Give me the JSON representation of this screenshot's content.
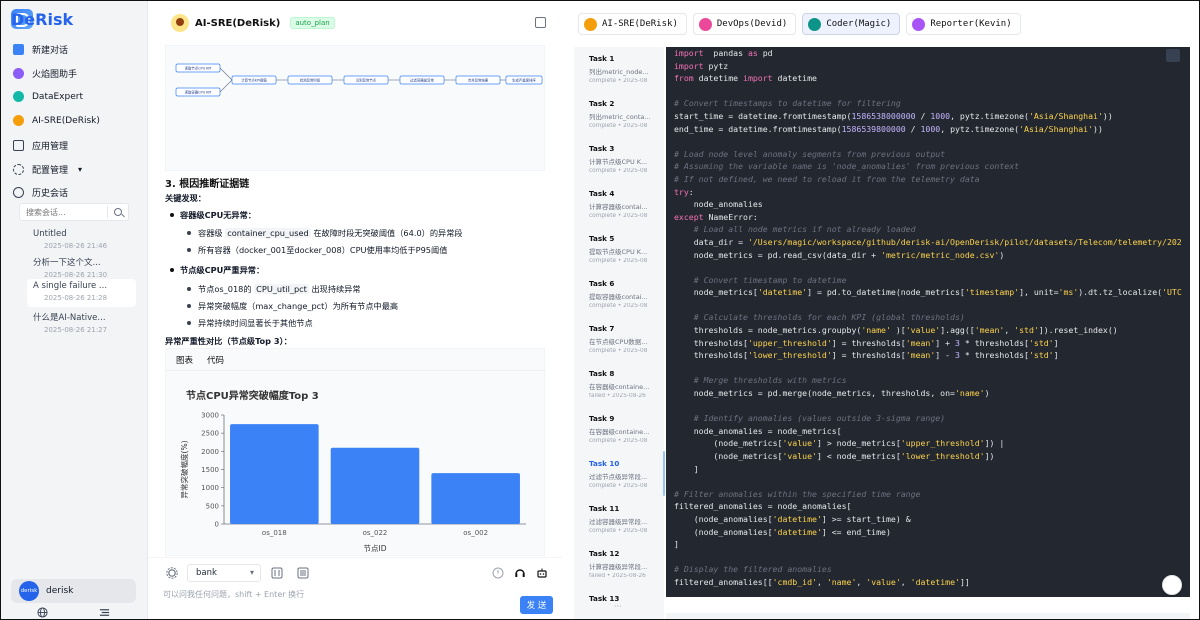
{
  "app": {
    "name": "DeRisk"
  },
  "sidebar": {
    "items": [
      {
        "label": "新建对话",
        "color": "#3b82f6"
      },
      {
        "label": "火焰图助手",
        "color": "#8b5cf6"
      },
      {
        "label": "DataExpert",
        "color": "#14b8a6"
      },
      {
        "label": "AI-SRE(DeRisk)",
        "color": "#f59e0b"
      },
      {
        "label": "应用管理",
        "color": "#6b7280"
      },
      {
        "label": "配置管理",
        "color": "#6b7280"
      },
      {
        "label": "历史会话",
        "color": "#6b7280"
      }
    ],
    "search_placeholder": "搜索会话...",
    "history": [
      {
        "title": "Untitled",
        "date": "2025-08-26 21:46"
      },
      {
        "title": "分析一下这个文...",
        "date": "2025-08-26 21:30"
      },
      {
        "title": "A single failure ...",
        "date": "2025-08-26 21:28"
      },
      {
        "title": "什么是AI-Native...",
        "date": "2025-08-26 21:27"
      }
    ],
    "user": {
      "avatar_text": "derisk",
      "name": "derisk"
    }
  },
  "chat": {
    "header_title": "AI-SRE(DeRisk)",
    "header_badge": "auto_plan",
    "section_title": "3. 根因推断证据链",
    "key_findings_label": "关键发现：",
    "finding1_title": "容器级CPU无异常：",
    "finding1_a_pre": "容器级",
    "finding1_a_code": "container_cpu_used",
    "finding1_a_post": "在故障时段无突破阈值（64.0）的异常段",
    "finding1_b": "所有容器（docker_001至docker_008）CPU使用率均低于P95阈值",
    "finding2_title": "节点级CPU严重异常：",
    "finding2_a_pre": "节点os_018的",
    "finding2_a_code": "CPU_util_pct",
    "finding2_a_post": "出现持续异常",
    "finding2_b": "异常突破幅度（max_change_pct）为所有节点中最高",
    "finding2_c": "异常持续时间显著长于其他节点",
    "compare_label": "异常严重性对比（节点级Top 3）：",
    "chart_tab_1": "图表",
    "chart_tab_2": "代码",
    "model_value": "bank",
    "input_placeholder": "可以问我任何问题，shift + Enter 换行",
    "send_label": "发 送",
    "flow_nodes": [
      "读取节点CPU KPI",
      "读取容器CPU KPI",
      "计算节点KPI阈值",
      "检测异常时段",
      "识别异常节点",
      "过滤容器级异常",
      "合并异常结果",
      "生成严重度排序"
    ]
  },
  "chart_data": {
    "type": "bar",
    "title": "节点CPU异常突破幅度Top 3",
    "xlabel": "节点ID",
    "ylabel": "异常突破幅度(%)",
    "categories": [
      "os_018",
      "os_022",
      "os_002"
    ],
    "values": [
      2750,
      2100,
      1400
    ],
    "ylim": [
      0,
      3000
    ],
    "yticks": [
      0,
      500,
      1000,
      1500,
      2000,
      2500,
      3000
    ],
    "bar_color": "#3b82f6",
    "grid": false
  },
  "right": {
    "tabs": [
      {
        "label": "AI-SRE(DeRisk)",
        "color": "#f59e0b",
        "active": false
      },
      {
        "label": "DevOps(Devid)",
        "color": "#ec4899",
        "active": false
      },
      {
        "label": "Coder(Magic)",
        "color": "#0d9488",
        "active": true
      },
      {
        "label": "Reporter(Kevin)",
        "color": "#a855f7",
        "active": false
      }
    ],
    "tasks": [
      {
        "name": "Task 1",
        "desc": "列出metric_node...",
        "status": "complete • 2025-08"
      },
      {
        "name": "Task 2",
        "desc": "列出metric_conta...",
        "status": "complete • 2025-08"
      },
      {
        "name": "Task 3",
        "desc": "计算节点级CPU K...",
        "status": "complete • 2025-08"
      },
      {
        "name": "Task 4",
        "desc": "计算容器级contai...",
        "status": "complete • 2025-08"
      },
      {
        "name": "Task 5",
        "desc": "提取节点级CPU K...",
        "status": "complete • 2025-08"
      },
      {
        "name": "Task 6",
        "desc": "提取容器级contai...",
        "status": "complete • 2025-08"
      },
      {
        "name": "Task 7",
        "desc": "在节点级CPU数据...",
        "status": "complete • 2025-08"
      },
      {
        "name": "Task 8",
        "desc": "在容器级containe...",
        "status": "failed • 2025-08-26"
      },
      {
        "name": "Task 9",
        "desc": "在容器级containe...",
        "status": "complete • 2025-08"
      },
      {
        "name": "Task 10",
        "desc": "过滤节点级异常段...",
        "status": "complete • 2025-08"
      },
      {
        "name": "Task 11",
        "desc": "过滤容器级异常段...",
        "status": "complete • 2025-08"
      },
      {
        "name": "Task 12",
        "desc": "计算容器级异常段...",
        "status": "failed • 2025-08-26"
      },
      {
        "name": "Task 13",
        "desc": "",
        "status": ""
      }
    ],
    "active_task_index": 9,
    "code_lines": [
      [
        [
          "kw",
          "import"
        ],
        [
          "",
          "  pandas "
        ],
        [
          "kw",
          "as"
        ],
        [
          "",
          " pd"
        ]
      ],
      [
        [
          "kw",
          "import"
        ],
        [
          "",
          " pytz"
        ]
      ],
      [
        [
          "kw",
          "from"
        ],
        [
          "",
          " datetime "
        ],
        [
          "kw",
          "import"
        ],
        [
          "",
          " datetime"
        ]
      ],
      [],
      [
        [
          "cm",
          "# Convert timestamps to datetime for filtering"
        ]
      ],
      [
        [
          "",
          "start_time = datetime.fromtimestamp("
        ],
        [
          "nu",
          "1586538000000"
        ],
        [
          "",
          " / "
        ],
        [
          "nu",
          "1000"
        ],
        [
          "",
          ", pytz.timezone("
        ],
        [
          "st",
          "'Asia/Shanghai'"
        ],
        [
          "",
          "))"
        ]
      ],
      [
        [
          "",
          "end_time = datetime.fromtimestamp("
        ],
        [
          "nu",
          "1586539800000"
        ],
        [
          "",
          " / "
        ],
        [
          "nu",
          "1000"
        ],
        [
          "",
          ", pytz.timezone("
        ],
        [
          "st",
          "'Asia/Shanghai'"
        ],
        [
          "",
          "))"
        ]
      ],
      [],
      [
        [
          "cm",
          "# Load node level anomaly segments from previous output"
        ]
      ],
      [
        [
          "cm",
          "# Assuming the variable name is 'node_anomalies' from previous context"
        ]
      ],
      [
        [
          "cm",
          "# If not defined, we need to reload it from the telemetry data"
        ]
      ],
      [
        [
          "kw",
          "try"
        ],
        [
          "",
          ":"
        ]
      ],
      [
        [
          "",
          "    node_anomalies"
        ]
      ],
      [
        [
          "kw",
          "except"
        ],
        [
          "",
          " NameError:"
        ]
      ],
      [
        [
          "",
          "    "
        ],
        [
          "cm",
          "# Load all node metrics if not already loaded"
        ]
      ],
      [
        [
          "",
          "    data_dir = "
        ],
        [
          "st",
          "'/Users/magic/workspace/github/derisk-ai/OpenDerisk/pilot/datasets/Telecom/telemetry/202"
        ]
      ],
      [
        [
          "",
          "    node_metrics = pd.read_csv(data_dir + "
        ],
        [
          "st",
          "'metric/metric_node.csv'"
        ],
        [
          "",
          ")"
        ]
      ],
      [],
      [
        [
          "",
          "    "
        ],
        [
          "cm",
          "# Convert timestamp to datetime"
        ]
      ],
      [
        [
          "",
          "    node_metrics["
        ],
        [
          "st",
          "'datetime'"
        ],
        [
          "",
          "] = pd.to_datetime(node_metrics["
        ],
        [
          "st",
          "'timestamp'"
        ],
        [
          "",
          "], unit="
        ],
        [
          "st",
          "'ms'"
        ],
        [
          "",
          ").dt.tz_localize("
        ],
        [
          "st",
          "'UTC"
        ]
      ],
      [],
      [
        [
          "",
          "    "
        ],
        [
          "cm",
          "# Calculate thresholds for each KPI (global thresholds)"
        ]
      ],
      [
        [
          "",
          "    thresholds = node_metrics.groupby("
        ],
        [
          "st",
          "'name'"
        ],
        [
          "",
          " )["
        ],
        [
          "st",
          "'value'"
        ],
        [
          "",
          "].agg(["
        ],
        [
          "st",
          "'mean'"
        ],
        [
          "",
          ", "
        ],
        [
          "st",
          "'std'"
        ],
        [
          "",
          "]).reset_index()"
        ]
      ],
      [
        [
          "",
          "    thresholds["
        ],
        [
          "st",
          "'upper_threshold'"
        ],
        [
          "",
          "] = thresholds["
        ],
        [
          "st",
          "'mean'"
        ],
        [
          "",
          "] + "
        ],
        [
          "nu",
          "3"
        ],
        [
          "",
          " * thresholds["
        ],
        [
          "st",
          "'std'"
        ],
        [
          "",
          "]"
        ]
      ],
      [
        [
          "",
          "    thresholds["
        ],
        [
          "st",
          "'lower_threshold'"
        ],
        [
          "",
          "] = thresholds["
        ],
        [
          "st",
          "'mean'"
        ],
        [
          "",
          "] - "
        ],
        [
          "nu",
          "3"
        ],
        [
          "",
          " * thresholds["
        ],
        [
          "st",
          "'std'"
        ],
        [
          "",
          "]"
        ]
      ],
      [],
      [
        [
          "",
          "    "
        ],
        [
          "cm",
          "# Merge thresholds with metrics"
        ]
      ],
      [
        [
          "",
          "    node_metrics = pd.merge(node_metrics, thresholds, on="
        ],
        [
          "st",
          "'name'"
        ],
        [
          "",
          ")"
        ]
      ],
      [],
      [
        [
          "",
          "    "
        ],
        [
          "cm",
          "# Identify anomalies (values outside 3-sigma range)"
        ]
      ],
      [
        [
          "",
          "    node_anomalies = node_metrics["
        ]
      ],
      [
        [
          "",
          "        (node_metrics["
        ],
        [
          "st",
          "'value'"
        ],
        [
          "",
          "] > node_metrics["
        ],
        [
          "st",
          "'upper_threshold'"
        ],
        [
          "",
          "]) |"
        ]
      ],
      [
        [
          "",
          "        (node_metrics["
        ],
        [
          "st",
          "'value'"
        ],
        [
          "",
          "] < node_metrics["
        ],
        [
          "st",
          "'lower_threshold'"
        ],
        [
          "",
          "])"
        ]
      ],
      [
        [
          "",
          "    ]"
        ]
      ],
      [],
      [
        [
          "cm",
          "# Filter anomalies within the specified time range"
        ]
      ],
      [
        [
          "",
          "filtered_anomalies = node_anomalies["
        ]
      ],
      [
        [
          "",
          "    (node_anomalies["
        ],
        [
          "st",
          "'datetime'"
        ],
        [
          "",
          "] >= start_time) &"
        ]
      ],
      [
        [
          "",
          "    (node_anomalies["
        ],
        [
          "st",
          "'datetime'"
        ],
        [
          "",
          "] <= end_time)"
        ]
      ],
      [
        [
          "",
          "]"
        ]
      ],
      [],
      [
        [
          "cm",
          "# Display the filtered anomalies"
        ]
      ],
      [
        [
          "",
          "filtered_anomalies[["
        ],
        [
          "st",
          "'cmdb_id'"
        ],
        [
          "",
          ", "
        ],
        [
          "st",
          "'name'"
        ],
        [
          "",
          ", "
        ],
        [
          "st",
          "'value'"
        ],
        [
          "",
          ", "
        ],
        [
          "st",
          "'datetime'"
        ],
        [
          "",
          "]]"
        ]
      ]
    ]
  }
}
